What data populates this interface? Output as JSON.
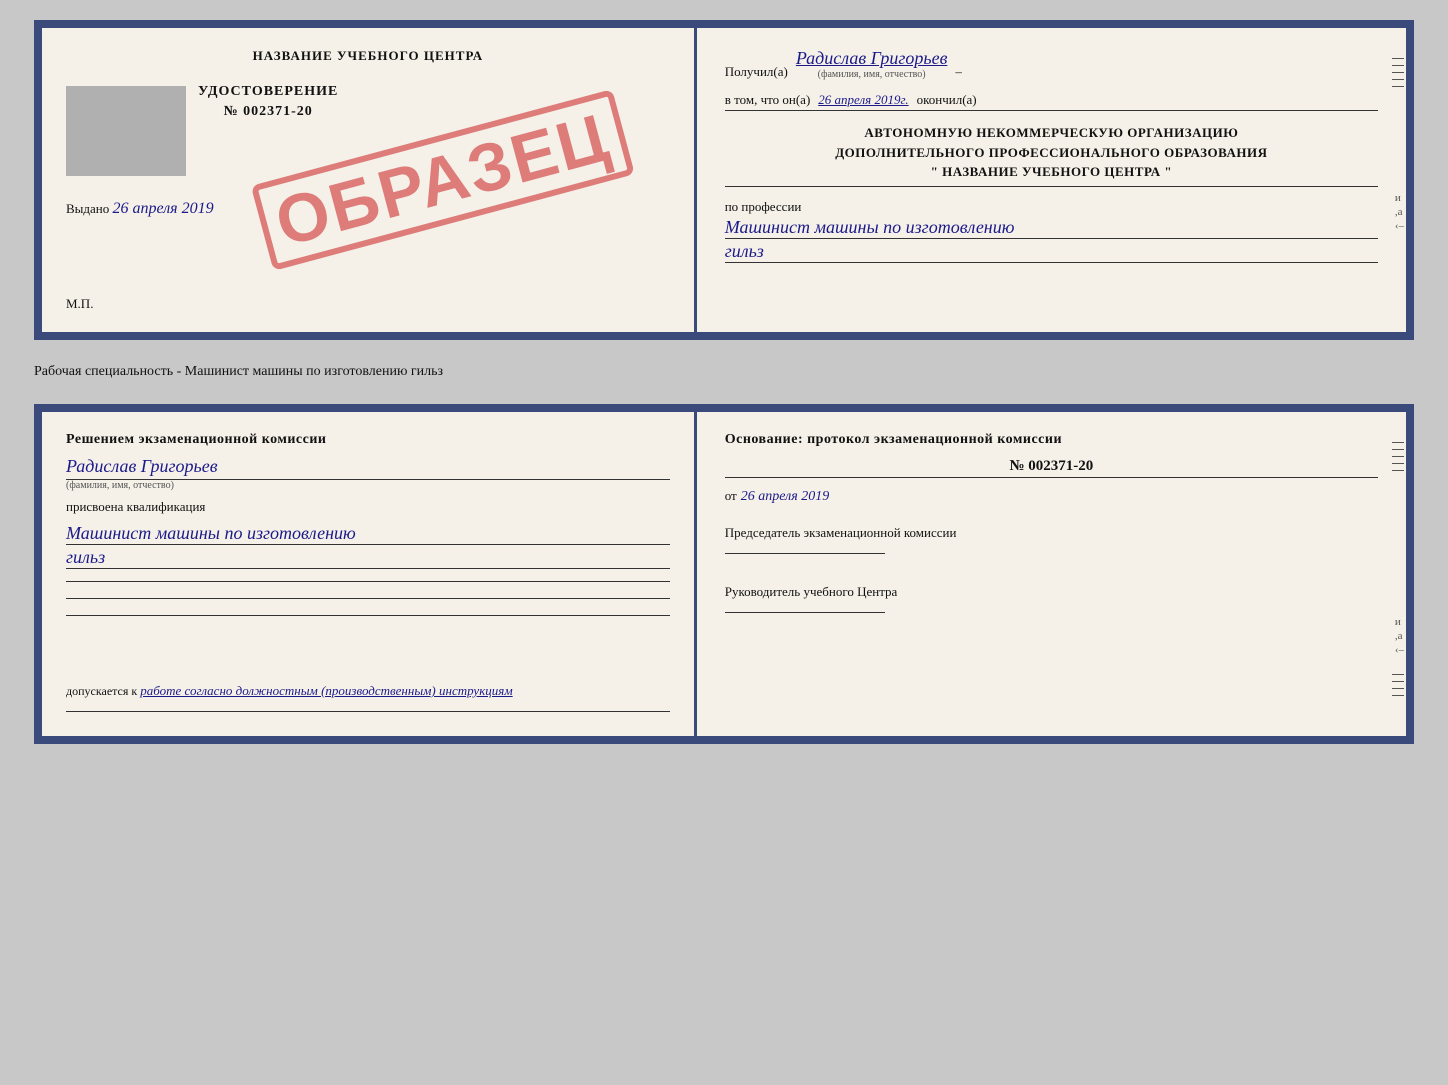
{
  "top_doc": {
    "left": {
      "title": "НАЗВАНИЕ УЧЕБНОГО ЦЕНТРА",
      "cert_label": "УДОСТОВЕРЕНИЕ",
      "cert_number": "№ 002371-20",
      "issued_label": "Выдано",
      "issued_date": "26 апреля 2019",
      "mp_label": "М.П.",
      "stamp_text": "ОБРАЗЕЦ"
    },
    "right": {
      "received_label": "Получил(а)",
      "received_name": "Радислав Григорьев",
      "name_sublabel": "(фамилия, имя, отчество)",
      "in_that_label": "в том, что он(а)",
      "in_that_date": "26 апреля 2019г.",
      "finished_label": "окончил(а)",
      "org_line1": "АВТОНОМНУЮ НЕКОММЕРЧЕСКУЮ ОРГАНИЗАЦИЮ",
      "org_line2": "ДОПОЛНИТЕЛЬНОГО ПРОФЕССИОНАЛЬНОГО ОБРАЗОВАНИЯ",
      "org_name": "\" НАЗВАНИЕ УЧЕБНОГО ЦЕНТРА \"",
      "profession_label": "по профессии",
      "profession_value": "Машинист машины по изготовлению",
      "profession_value2": "гильз"
    }
  },
  "specialty_label": "Рабочая специальность - Машинист машины по изготовлению гильз",
  "bottom_doc": {
    "left": {
      "header": "Решением экзаменационной комиссии",
      "name_value": "Радислав Григорьев",
      "name_sublabel": "(фамилия, имя, отчество)",
      "assigned_label": "присвоена квалификация",
      "qual_value": "Машинист машины по изготовлению",
      "qual_value2": "гильз",
      "allowed_label": "допускается к",
      "allowed_value": "работе согласно должностным (производственным) инструкциям"
    },
    "right": {
      "header": "Основание: протокол экзаменационной комиссии",
      "number": "№ 002371-20",
      "date_prefix": "от",
      "date_value": "26 апреля 2019",
      "chairman_label": "Председатель экзаменационной комиссии",
      "director_label": "Руководитель учебного Центра"
    }
  }
}
